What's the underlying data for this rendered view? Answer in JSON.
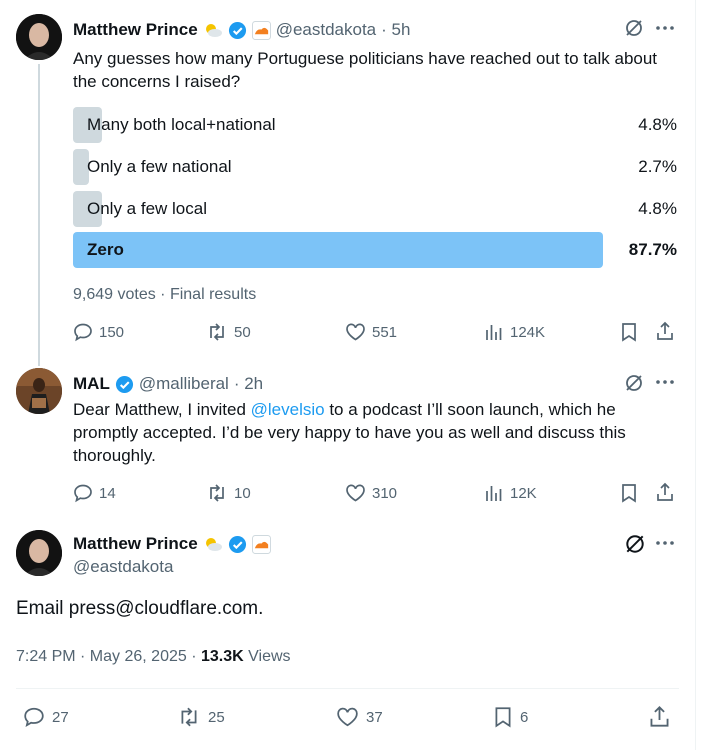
{
  "tweet1": {
    "author_name": "Matthew Prince",
    "handle": "@eastdakota",
    "time": "· 5h",
    "text": "Any guesses how many Portuguese politicians have reached out to talk about the concerns I raised?",
    "poll": {
      "options": [
        {
          "label": "Many both local+national",
          "percent": "4.8%",
          "share": 4.8
        },
        {
          "label": "Only a few national",
          "percent": "2.7%",
          "share": 2.7
        },
        {
          "label": "Only a few local",
          "percent": "4.8%",
          "share": 4.8
        },
        {
          "label": "Zero",
          "percent": "87.7%",
          "share": 87.7
        }
      ],
      "footer": "9,649 votes · Final results"
    },
    "actions": {
      "replies": "150",
      "reposts": "50",
      "likes": "551",
      "views": "124K"
    }
  },
  "tweet2": {
    "author_name": "MAL",
    "handle": "@malliberal",
    "time": "· 2h",
    "text_before": "Dear Matthew, I invited ",
    "mention": "@levelsio",
    "text_after": " to a podcast I’ll soon launch, which he promptly accepted. I’d be very happy to have you as well and discuss this thoroughly.",
    "actions": {
      "replies": "14",
      "reposts": "10",
      "likes": "310",
      "views": "12K"
    }
  },
  "tweet3": {
    "author_name": "Matthew Prince",
    "handle": "@eastdakota",
    "text": "Email press@cloudflare.com.",
    "timestamp": "7:24 PM · May 26, 2025 · ",
    "views_count": "13.3K",
    "views_label": " Views",
    "actions": {
      "replies": "27",
      "reposts": "25",
      "likes": "37",
      "bookmarks": "6"
    }
  },
  "colors": {
    "accent": "#1d9bf0",
    "poll_winner": "#7cc3f7",
    "poll_other": "#cfd9de",
    "muted": "#536471"
  }
}
